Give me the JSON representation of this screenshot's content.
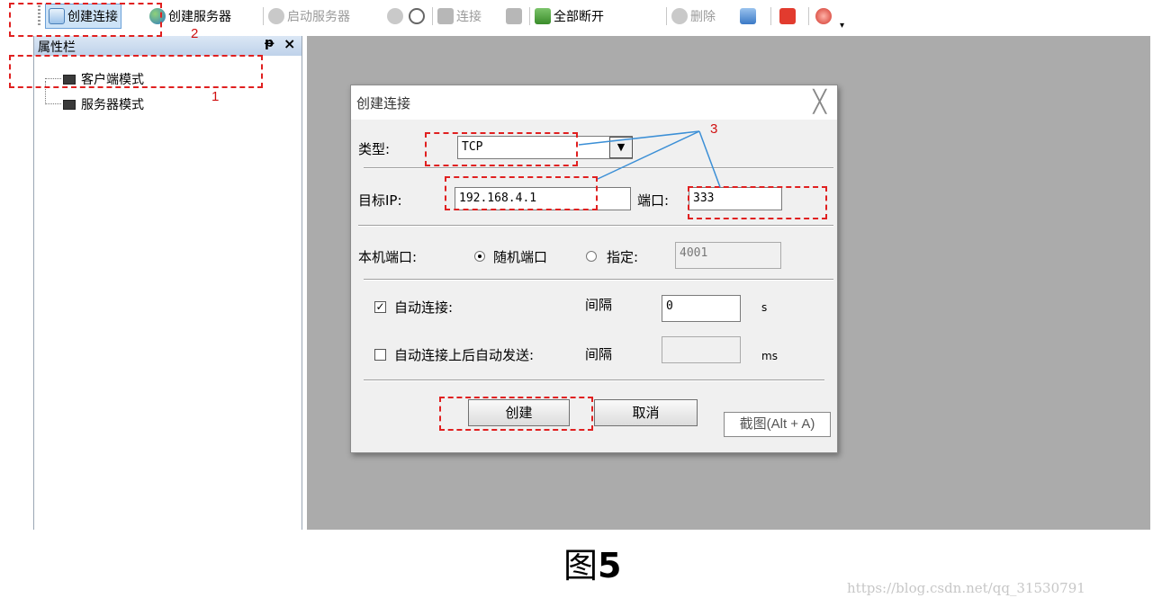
{
  "toolbar": {
    "items": [
      {
        "label": "创建连接",
        "icon": "new-connection-icon"
      },
      {
        "label": "创建服务器",
        "icon": "create-server-icon"
      },
      {
        "label": "启动服务器",
        "icon": "start-server-icon"
      },
      {
        "label": "",
        "icon": "stop-server-icon"
      },
      {
        "label": "",
        "icon": "close-circle-icon"
      },
      {
        "label": "连接",
        "icon": "connect-icon"
      },
      {
        "label": "",
        "icon": "disconnect-icon"
      },
      {
        "label": "全部断开",
        "icon": "disconnect-all-icon"
      },
      {
        "label": "删除",
        "icon": "delete-icon"
      },
      {
        "label": "",
        "icon": "delete-all-icon"
      },
      {
        "label": "",
        "icon": "power-icon"
      },
      {
        "label": "",
        "icon": "fan-icon"
      }
    ]
  },
  "panel": {
    "title": "属性栏",
    "pin": "ᵽ",
    "close": "×",
    "tree": [
      "客户端模式",
      "服务器模式"
    ]
  },
  "dialog": {
    "title": "创建连接",
    "close": "╳",
    "type_label": "类型:",
    "type_value": "TCP",
    "ip_label": "目标IP:",
    "ip_value": "192.168.4.1",
    "port_label": "端口:",
    "port_value": "333",
    "local_port_label": "本机端口:",
    "random_port_label": "随机端口",
    "specify_label": "指定:",
    "specify_value": "4001",
    "auto_connect_label": "自动连接:",
    "auto_connect_checked": true,
    "interval_label": "间隔",
    "interval_value": "0",
    "interval_unit": "s",
    "auto_send_label": "自动连接上后自动发送:",
    "auto_send_checked": false,
    "interval2_label": "间隔",
    "interval2_value": "",
    "interval2_unit": "ms",
    "create_button": "创建",
    "cancel_button": "取消"
  },
  "tooltip": "截图(Alt + A)",
  "annotations": {
    "one": "1",
    "two": "2",
    "three": "3"
  },
  "caption": {
    "prefix": "图",
    "number": "5"
  },
  "watermark": "https://blog.csdn.net/qq_31530791",
  "colors": {
    "accent": "#e02020",
    "workspace": "#ababab",
    "callout_line": "#3b8fd6"
  }
}
